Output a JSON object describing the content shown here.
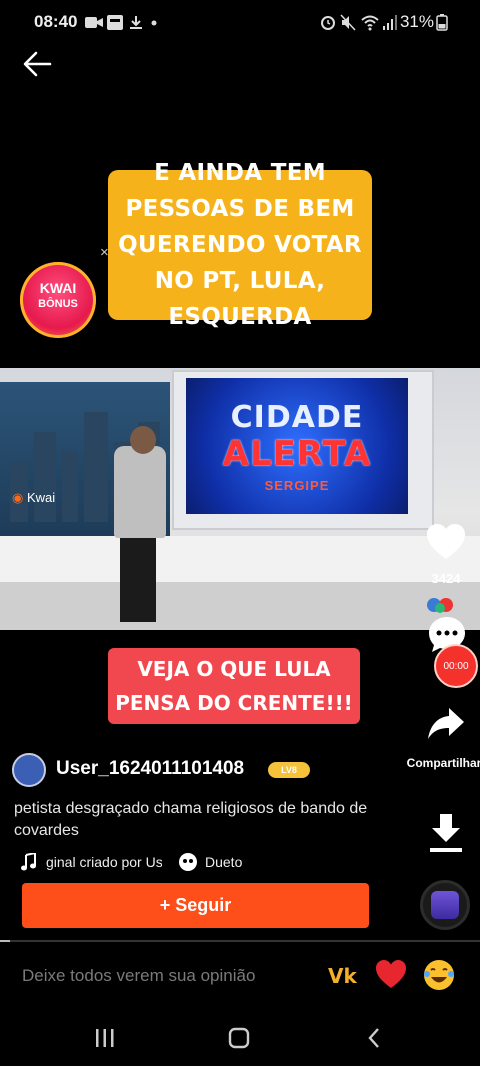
{
  "status_bar": {
    "time": "08:40",
    "battery": "31%"
  },
  "video": {
    "caption_top": "E AINDA TEM PESSOAS DE BEM QUERENDO VOTAR NO PT, LULA, ESQUERDA",
    "caption_close": "×",
    "bonus_line1": "KWAI",
    "bonus_line2": "BÔNUS",
    "screen_line1": "CIDADE",
    "screen_line2": "ALERTA",
    "screen_line3": "SERGIPE",
    "watermark": "Kwai",
    "caption_mid": "VEJA O QUE LULA PENSA DO CRENTE!!!",
    "progress_fraction": 0.02
  },
  "rail": {
    "like_count": "3424",
    "timer": "00:00",
    "share_label": "Compartilhar"
  },
  "author": {
    "username": "User_1624011101408",
    "level": "LV8",
    "description": "petista desgraçado chama religiosos de bando de covardes",
    "music": "ginal criado por Us",
    "duet_label": "Dueto",
    "follow_label": "+ Seguir"
  },
  "comment_bar": {
    "placeholder": "Deixe todos verem sua opinião"
  },
  "colors": {
    "caption_yellow": "#f6b21a",
    "caption_red": "#f1474f",
    "follow_orange": "#fe4e1a"
  }
}
